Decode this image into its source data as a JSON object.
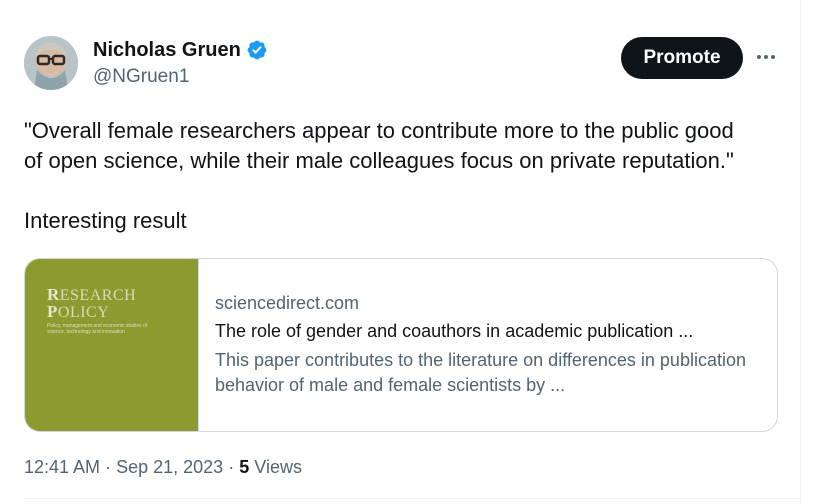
{
  "author": {
    "name": "Nicholas Gruen",
    "handle": "@NGruen1",
    "verified_color": "#1d9bf0"
  },
  "header": {
    "promote_label": "Promote",
    "more_icon": "more-horizontal-icon"
  },
  "tweet": {
    "text": "\"Overall female researchers appear to contribute more to the public good\nof open science, while their male colleagues focus on private reputation.\"\n\nInteresting result"
  },
  "card": {
    "thumbnail": {
      "title_line1_cap": "R",
      "title_line1": "ESEARCH",
      "title_line2_cap": "P",
      "title_line2": "OLICY",
      "subtitle": "Policy, management and economic studies of science, technology and innovation",
      "background": "#8d9a2f"
    },
    "domain": "sciencedirect.com",
    "title": "The role of gender and coauthors in academic publication ...",
    "description": "This paper contributes to the literature on differences in publication behavior of male and female scientists by ..."
  },
  "meta": {
    "time": "12:41 AM",
    "separator": "·",
    "date": "Sep 21, 2023",
    "views_count": "5",
    "views_label": "Views"
  }
}
